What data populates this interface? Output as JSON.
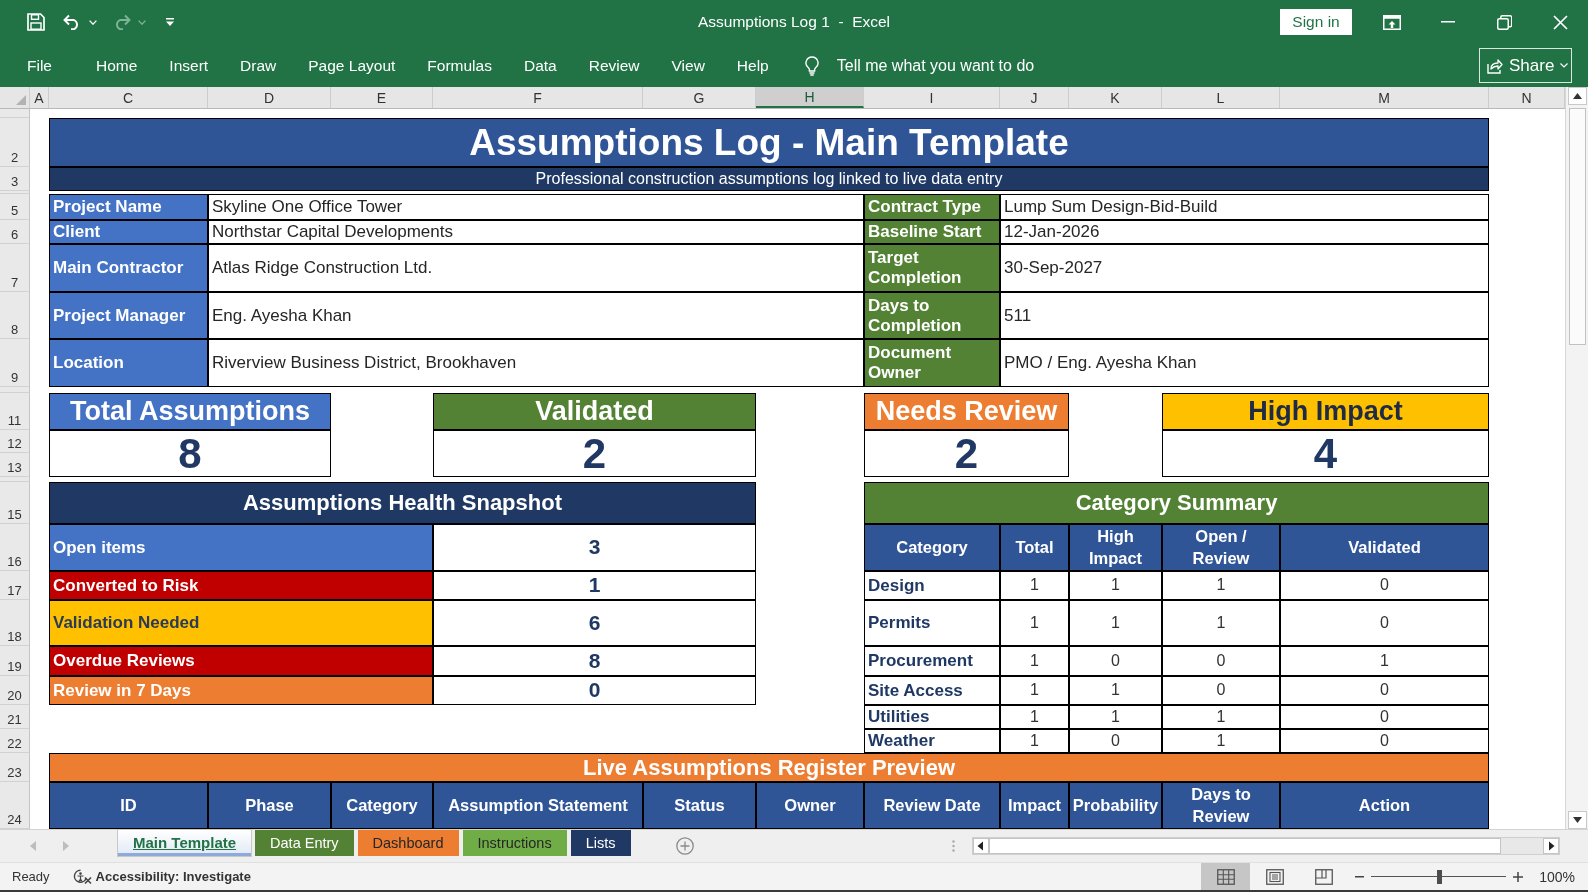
{
  "window": {
    "title": "Assumptions Log 1  -  Excel",
    "sign_in": "Sign in"
  },
  "ribbon": {
    "tabs": [
      {
        "label": "File",
        "selected": false
      },
      {
        "label": "Home",
        "selected": false
      },
      {
        "label": "Insert",
        "selected": false
      },
      {
        "label": "Draw",
        "selected": false
      },
      {
        "label": "Page Layout",
        "selected": false
      },
      {
        "label": "Formulas",
        "selected": false
      },
      {
        "label": "Data",
        "selected": false
      },
      {
        "label": "Review",
        "selected": false
      },
      {
        "label": "View",
        "selected": false
      },
      {
        "label": "Help",
        "selected": false
      }
    ],
    "tell_me": {
      "placeholder": "Tell me what you want to do"
    },
    "share": "Share"
  },
  "sheet": {
    "column_headers": [
      {
        "label": "A",
        "selected": false
      },
      {
        "label": "C",
        "selected": false
      },
      {
        "label": "D",
        "selected": false
      },
      {
        "label": "E",
        "selected": false
      },
      {
        "label": "F",
        "selected": false
      },
      {
        "label": "G",
        "selected": false
      },
      {
        "label": "H",
        "selected": true
      },
      {
        "label": "I",
        "selected": false
      },
      {
        "label": "J",
        "selected": false
      },
      {
        "label": "K",
        "selected": false
      },
      {
        "label": "L",
        "selected": false
      },
      {
        "label": "M",
        "selected": false
      },
      {
        "label": "N",
        "selected": false
      }
    ],
    "row_headers": [
      "2",
      "3",
      "5",
      "6",
      "7",
      "8",
      "9",
      "11",
      "12",
      "13",
      "15",
      "16",
      "17",
      "18",
      "19",
      "20",
      "21",
      "22",
      "23",
      "24"
    ],
    "title": "Assumptions Log - Main Template",
    "subtitle": "Professional construction assumptions log linked to live data entry",
    "project_info": {
      "left": [
        {
          "label": "Project Name",
          "value": "Skyline One Office Tower"
        },
        {
          "label": "Client",
          "value": "Northstar Capital Developments"
        },
        {
          "label": "Main Contractor",
          "value": "Atlas Ridge Construction Ltd."
        },
        {
          "label": "Project Manager",
          "value": "Eng. Ayesha Khan"
        },
        {
          "label": "Location",
          "value": "Riverview Business District, Brookhaven"
        }
      ],
      "right": [
        {
          "label": "Contract Type",
          "value": "Lump Sum Design-Bid-Build"
        },
        {
          "label": "Baseline Start",
          "value": "12-Jan-2026"
        },
        {
          "label": "Target Completion",
          "value": "30-Sep-2027"
        },
        {
          "label": "Days to Completion",
          "value": "511"
        },
        {
          "label": "Document Owner",
          "value": "PMO / Eng. Ayesha Khan"
        }
      ]
    },
    "kpis": [
      {
        "label": "Total Assumptions",
        "value": "8",
        "color": "#4472c4"
      },
      {
        "label": "Validated",
        "value": "2",
        "color": "#548235"
      },
      {
        "label": "Needs Review",
        "value": "2",
        "color": "#ed7d31"
      },
      {
        "label": "High Impact",
        "value": "4",
        "color": "#ffc000"
      }
    ],
    "health_snapshot": {
      "title": "Assumptions Health Snapshot",
      "rows": [
        {
          "label": "Open items",
          "value": "3",
          "color": "#4472c4"
        },
        {
          "label": "Converted to Risk",
          "value": "1",
          "color": "#c00000"
        },
        {
          "label": "Validation Needed",
          "value": "6",
          "color": "#ffc000"
        },
        {
          "label": "Overdue Reviews",
          "value": "8",
          "color": "#c00000"
        },
        {
          "label": "Review in 7 Days",
          "value": "0",
          "color": "#ed7d31"
        }
      ]
    },
    "category_summary": {
      "title": "Category Summary",
      "columns": [
        "Category",
        "Total",
        "High Impact",
        "Open / Review",
        "Validated"
      ],
      "rows": [
        {
          "cells": [
            "Design",
            "1",
            "1",
            "1",
            "0"
          ]
        },
        {
          "cells": [
            "Permits",
            "1",
            "1",
            "1",
            "0"
          ]
        },
        {
          "cells": [
            "Procurement",
            "1",
            "0",
            "0",
            "1"
          ]
        },
        {
          "cells": [
            "Site Access",
            "1",
            "1",
            "0",
            "0"
          ]
        },
        {
          "cells": [
            "Utilities",
            "1",
            "1",
            "1",
            "0"
          ]
        },
        {
          "cells": [
            "Weather",
            "1",
            "0",
            "1",
            "0"
          ]
        }
      ]
    },
    "register_preview": {
      "title": "Live Assumptions Register Preview",
      "columns": [
        "ID",
        "Phase",
        "Category",
        "Assumption Statement",
        "Status",
        "Owner",
        "Review Date",
        "Impact",
        "Probability",
        "Days to Review",
        "Action"
      ]
    }
  },
  "sheet_tabs": [
    {
      "label": "Main Template",
      "selected": true,
      "color": "#8eaadb"
    },
    {
      "label": "Data Entry",
      "selected": false,
      "color": "#548235"
    },
    {
      "label": "Dashboard",
      "selected": false,
      "color": "#ed7d31"
    },
    {
      "label": "Instructions",
      "selected": false,
      "color": "#70ad47"
    },
    {
      "label": "Lists",
      "selected": false,
      "color": "#1f3864"
    }
  ],
  "status_bar": {
    "status": "Ready",
    "accessibility": "Accessibility: Investigate",
    "views": [
      {
        "kind": "normal",
        "selected": true
      },
      {
        "kind": "page_layout",
        "selected": false
      },
      {
        "kind": "page_break",
        "selected": false
      }
    ],
    "zoom": {
      "level": 0.5,
      "reading": "100%"
    }
  }
}
